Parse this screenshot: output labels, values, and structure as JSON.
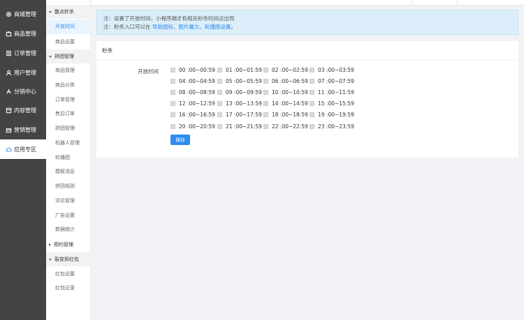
{
  "nav1": [
    {
      "label": "商城管理",
      "icon": "settings-icon"
    },
    {
      "label": "商品管理",
      "icon": "goods-icon"
    },
    {
      "label": "订单管理",
      "icon": "order-icon"
    },
    {
      "label": "用户管理",
      "icon": "user-icon"
    },
    {
      "label": "分销中心",
      "icon": "share-icon"
    },
    {
      "label": "内容管理",
      "icon": "content-icon"
    },
    {
      "label": "营销管理",
      "icon": "marketing-icon"
    },
    {
      "label": "应用专区",
      "icon": "cloud-icon"
    }
  ],
  "nav2": {
    "groups": [
      {
        "label": "整点秒杀",
        "items": [
          "开放时间",
          "商品设置"
        ]
      },
      {
        "label": "拼团管理",
        "items": [
          "商品管理",
          "商品分类",
          "订单管理",
          "售后订单",
          "拼团管理",
          "机器人管理",
          "轮播图",
          "模板消息",
          "拼团规则",
          "评论管理",
          "广告设置",
          "数据统计"
        ]
      },
      {
        "label": "预约管理",
        "items": []
      },
      {
        "label": "裂变拆红包",
        "items": [
          "红包设置",
          "红包记录"
        ]
      }
    ]
  },
  "note": {
    "line1": "注：设置了开放时间，小程序端才有相关秒杀时间点出现",
    "line2_prefix": "注：秒杀入口可以在",
    "link1": "导航图标",
    "sep1": "、",
    "link2": "图片魔方",
    "sep2": "、",
    "link3": "轮播图设置",
    "line2_suffix": "。"
  },
  "card": {
    "title": "秒杀",
    "form_label": "开放时间",
    "slots": [
      "00 :00~00:59",
      "01 :00~01:59",
      "02 :00~02:59",
      "03 :00~03:59",
      "04 :00~04:59",
      "05 :00~05:59",
      "06 :00~06:59",
      "07 :00~07:59",
      "08 :00~08:59",
      "09 :00~09:59",
      "10 :00~10:59",
      "11 :00~11:59",
      "12 :00~12:59",
      "13 :00~13:59",
      "14 :00~14:59",
      "15 :00~15:59",
      "16 :00~16:59",
      "17 :00~17:59",
      "18 :00~18:59",
      "19 :00~19:59",
      "20 :00~20:59",
      "21 :00~21:59",
      "22 :00~22:59",
      "23 :00~23:59"
    ],
    "save_label": "保存"
  },
  "colors": {
    "accent": "#2d8cf0",
    "sidebar_bg": "#444444",
    "note_bg": "#dbeef9"
  }
}
